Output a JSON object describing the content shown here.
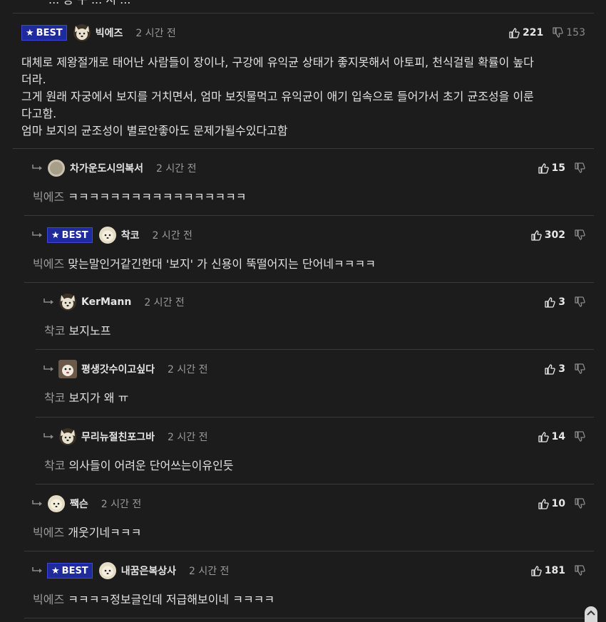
{
  "top_fragment": "... 등 구 ... 서 ...",
  "badge_label": "BEST",
  "comments": [
    {
      "nick": "빅에즈",
      "time": "2 시간 전",
      "up": "221",
      "down": "153",
      "best": true,
      "lines": [
        "대체로 제왕절개로 태어난 사람들이 장이나, 구강에 유익균 상태가 좋지못해서 아토피, 천식걸릴 확률이 높다",
        "더라.",
        "그게 원래 자궁에서 보지를 거치면서, 엄마 보짓물먹고 유익균이 애기 입속으로 들어가서 초기 균조성을 이룬",
        "다고함.",
        "엄마 보지의 균조성이 별로안좋아도 문제가될수있다고함"
      ]
    },
    {
      "nick": "차가운도시의복서",
      "time": "2 시간 전",
      "up": "15",
      "mention": "빅에즈",
      "text": "ㅋㅋㅋㅋㅋㅋㅋㅋㅋㅋㅋㅋㅋㅋㅋㅋㅋ"
    },
    {
      "nick": "착코",
      "time": "2 시간 전",
      "up": "302",
      "best": true,
      "mention": "빅에즈",
      "text": "맞는말인거같긴한대 '보지' 가 신용이 뚝떨어지는 단어네ㅋㅋㅋㅋ"
    },
    {
      "nick": "KerMann",
      "time": "2 시간 전",
      "up": "3",
      "mention": "착코",
      "text": "보지노프"
    },
    {
      "nick": "평생갓수이고싶다",
      "time": "2 시간 전",
      "up": "3",
      "mention": "착코",
      "text": "보지가 왜 ㅠ"
    },
    {
      "nick": "무리뉴절친포그바",
      "time": "2 시간 전",
      "up": "14",
      "mention": "착코",
      "text": "의사들이 어려운 단어쓰는이유인듯"
    },
    {
      "nick": "짹슨",
      "time": "2 시간 전",
      "up": "10",
      "mention": "빅에즈",
      "text": "개웃기네ㅋㅋㅋ"
    },
    {
      "nick": "내꿈은복상사",
      "time": "2 시간 전",
      "up": "181",
      "best": true,
      "mention": "빅에즈",
      "text": "ㅋㅋㅋㅋ정보글인데 저급해보이네 ㅋㅋㅋㅋ"
    }
  ],
  "colors": {
    "background": "#1c1c1c",
    "best_badge": "#1f2a9c",
    "divider": "#3a3a3a"
  }
}
